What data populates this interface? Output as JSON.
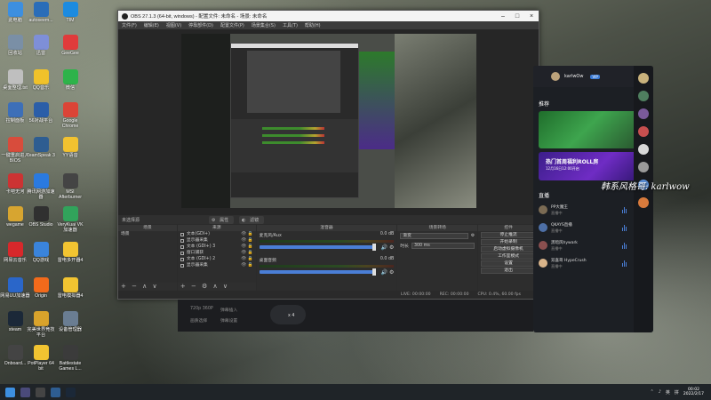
{
  "desktop": {
    "icons": [
      {
        "label": "此电脑",
        "color": "#3d8fe0"
      },
      {
        "label": "autoseem...",
        "color": "#2a6db8"
      },
      {
        "label": "TIM",
        "color": "#1c8be0"
      },
      {
        "label": "回收站",
        "color": "#7a8fa6"
      },
      {
        "label": "迅雷",
        "color": "#7e8fd8"
      },
      {
        "label": "GeeGee",
        "color": "#e03b3b"
      },
      {
        "label": "桌面整理.txt",
        "color": "#bfbfbf"
      },
      {
        "label": "QQ音乐",
        "color": "#f0c22a"
      },
      {
        "label": "微信",
        "color": "#2eb34a"
      },
      {
        "label": "控制面板",
        "color": "#3d6fb8"
      },
      {
        "label": "56对战平台",
        "color": "#2b5ea8"
      },
      {
        "label": "Google Chrome",
        "color": "#db4437"
      },
      {
        "label": "一键重启进入BIOS",
        "color": "#d84c3c"
      },
      {
        "label": "TeamSpeak 3",
        "color": "#2e5d91"
      },
      {
        "label": "YY语音",
        "color": "#f2c230"
      },
      {
        "label": "卡吧无河",
        "color": "#c33"
      },
      {
        "label": "腾讯网游加速器",
        "color": "#2a7ae0"
      },
      {
        "label": "MSI Afterburner",
        "color": "#444"
      },
      {
        "label": "wegame",
        "color": "#d7a530"
      },
      {
        "label": "OBS Studio",
        "color": "#303030"
      },
      {
        "label": "VeryKuai VK加速器",
        "color": "#31a35b"
      },
      {
        "label": "网易云音乐",
        "color": "#d8282b"
      },
      {
        "label": "QQ游戏",
        "color": "#3a84dc"
      },
      {
        "label": "雷电多开器4",
        "color": "#f2c431"
      },
      {
        "label": "网易UU加速器",
        "color": "#2a66c9"
      },
      {
        "label": "Origin",
        "color": "#f26a1b"
      },
      {
        "label": "雷电模拟器4",
        "color": "#f2c431"
      },
      {
        "label": "steam",
        "color": "#1b2838"
      },
      {
        "label": "完美世界竞技平台",
        "color": "#d9a32b"
      },
      {
        "label": "设备管理器",
        "color": "#6a7d92"
      },
      {
        "label": "Onboard...",
        "color": "#444"
      },
      {
        "label": "PotPlayer 64 bit",
        "color": "#f2c431"
      },
      {
        "label": "Battlestate Games L...",
        "color": "#3b3b3b"
      }
    ]
  },
  "obs": {
    "title": "OBS 27.1.3 (64-bit, windows) - 配置文件: 未命名 - 场景: 未命名",
    "menu": [
      "文件(F)",
      "编辑(E)",
      "视图(V)",
      "停靠部件(D)",
      "配置文件(P)",
      "场景集合(S)",
      "工具(T)",
      "帮助(H)"
    ],
    "dock_bar": {
      "scene_label": "未选择源",
      "props_label": "属性",
      "filter_label": "滤镜"
    },
    "scenes": {
      "header": "场景",
      "items": [
        "场景"
      ],
      "toolbar": "+ − ∧ ∨"
    },
    "sources": {
      "header": "来源",
      "items": [
        {
          "name": "文本(GDI+)",
          "tail": ""
        },
        {
          "name": "显示器采集",
          "tail": ""
        },
        {
          "name": "文本 (GDI+) 3",
          "tail": ""
        },
        {
          "name": "窗口捕获",
          "tail": ""
        },
        {
          "name": "文本 (GDI+) 2",
          "tail": ""
        },
        {
          "name": "显示器采集",
          "tail": ""
        }
      ],
      "toolbar": "+ − ⚙ ∧ ∨"
    },
    "mixer": {
      "header": "混音器",
      "tracks": [
        {
          "name": "麦克风/Aux",
          "db": "0.0 dB"
        },
        {
          "name": "桌面音频",
          "db": "0.0 dB"
        }
      ]
    },
    "transitions": {
      "header": "场景转场",
      "type": "渐变",
      "duration_label": "时长",
      "duration": "300 ms"
    },
    "controls": {
      "header": "控件",
      "buttons": [
        "停止推流",
        "开始录制",
        "启动虚拟摄像机",
        "工作室模式",
        "设置",
        "退出"
      ]
    },
    "status": {
      "live": "LIVE: 00:00:00",
      "rec": "REC: 00:00:00",
      "cpu": "CPU: 0.4%, 60.00 fps"
    }
  },
  "chat": {
    "user": "karlwOw",
    "vip": "VIP",
    "section_title": "推荐",
    "banner2_title": "热门首周福利ROLL房",
    "banner2_sub": "12月16日12:00开启",
    "live_title": "直播",
    "live_more": "更多 >",
    "live_items": [
      {
        "name": "PP大魔王",
        "sub": "直播中",
        "color": "#7b6b54"
      },
      {
        "name": "QKAYS直播",
        "sub": "直播中",
        "color": "#4d6fa6"
      },
      {
        "name": "黑暗风hywark",
        "sub": "直播中",
        "color": "#8a4f4f"
      },
      {
        "name": "双喜哥 HypeCrush",
        "sub": "直播中",
        "color": "#d9b48a"
      }
    ]
  },
  "overlay_text": "韩系风格哥: karlwow",
  "player": {
    "left_a": "720p 360P",
    "left_b": "画质选择",
    "mid_a": "弹幕插入",
    "mid_b": "弹幕设置",
    "count": "x 4"
  },
  "taskbar": {
    "time": "00:02",
    "date": "2022/2/17",
    "lang": "英",
    "ime": "拼"
  }
}
